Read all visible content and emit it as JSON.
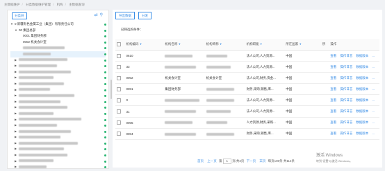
{
  "breadcrumb": [
    "主数据维护",
    "分类数据维护管理",
    "机构",
    "主数据查询"
  ],
  "left": {
    "tab_label": "分类树",
    "tree": [
      {
        "indent": 0,
        "toggle": "▼",
        "label": "0 新疆有色金属工业（集团）有限责任公司",
        "blur": 0,
        "dot": true
      },
      {
        "indent": 1,
        "toggle": "▼",
        "label": "00 集团总部",
        "blur": 0,
        "dot": true
      },
      {
        "indent": 2,
        "toggle": "",
        "label": "0001 集团财务部",
        "blur": 0,
        "dot": true
      },
      {
        "indent": 2,
        "toggle": "",
        "label": "0002 机关会计室",
        "blur": 0,
        "dot": true
      },
      {
        "indent": 2,
        "toggle": "",
        "label": "",
        "blur": 60,
        "dot": true
      },
      {
        "indent": 2,
        "toggle": "",
        "label": "",
        "blur": 40,
        "dot": true,
        "sel": true
      },
      {
        "indent": 1,
        "toggle": "▶",
        "label": "",
        "blur": 70,
        "dot": true
      },
      {
        "indent": 1,
        "toggle": "▶",
        "label": "",
        "blur": 55,
        "dot": true
      },
      {
        "indent": 1,
        "toggle": "▶",
        "label": "",
        "blur": 75,
        "dot": true
      },
      {
        "indent": 1,
        "toggle": "▶",
        "label": "",
        "blur": 50,
        "dot": true
      },
      {
        "indent": 1,
        "toggle": "▶",
        "label": "",
        "blur": 65,
        "dot": true
      },
      {
        "indent": 1,
        "toggle": "▶",
        "label": "",
        "blur": 45,
        "dot": true
      },
      {
        "indent": 1,
        "toggle": "▶",
        "label": "",
        "blur": 80,
        "dot": true
      },
      {
        "indent": 1,
        "toggle": "▶",
        "label": "",
        "blur": 60,
        "dot": true
      },
      {
        "indent": 1,
        "toggle": "▶",
        "label": "",
        "blur": 70,
        "dot": true
      },
      {
        "indent": 1,
        "toggle": "▶",
        "label": "",
        "blur": 50,
        "dot": true
      },
      {
        "indent": 1,
        "toggle": "▶",
        "label": "",
        "blur": 90,
        "dot": true
      },
      {
        "indent": 1,
        "toggle": "▶",
        "label": "",
        "blur": 55,
        "dot": true
      },
      {
        "indent": 1,
        "toggle": "▶",
        "label": "",
        "blur": 75,
        "dot": true
      },
      {
        "indent": 1,
        "toggle": "▶",
        "label": "",
        "blur": 60,
        "dot": true
      },
      {
        "indent": 1,
        "toggle": "▶",
        "label": "",
        "blur": 85,
        "dot": true
      },
      {
        "indent": 1,
        "toggle": "▶",
        "label": "",
        "blur": 65,
        "dot": true
      },
      {
        "indent": 1,
        "toggle": "▶",
        "label": "",
        "blur": 70,
        "dot": true
      },
      {
        "indent": 1,
        "toggle": "▶",
        "label": "",
        "blur": 50,
        "dot": true
      },
      {
        "indent": 1,
        "toggle": "▶",
        "label": "",
        "blur": 40,
        "dot": true
      }
    ]
  },
  "toolbar": {
    "export_label": "导出数据",
    "share_label": "分发"
  },
  "filter_label": "已筛选的条件：",
  "table": {
    "headers": [
      "机构编码",
      "机构名称",
      "机构简称",
      "机构职能",
      "所在国家",
      "所",
      "操作"
    ],
    "rows": [
      {
        "code": "0610",
        "name": "",
        "short": "",
        "func": "法人公司,人力资源...",
        "country": "中国"
      },
      {
        "code": "33",
        "name": "",
        "short": "",
        "func": "法人公司,人力资源...",
        "country": "中国"
      },
      {
        "code": "0002",
        "name": "机关会计室",
        "short": "机关会计室",
        "func": "法人公司,财务,资金...",
        "country": "中国"
      },
      {
        "code": "0001",
        "name": "集团财务部",
        "short": "",
        "func": "财务,采购,销售,库...",
        "country": "中国"
      },
      {
        "code": "0",
        "name": "",
        "short": "",
        "func": "法人公司,人力资源...",
        "country": "中国"
      },
      {
        "code": "31",
        "name": "",
        "short": "",
        "func": "法人公司,人力资源...",
        "country": "中国"
      },
      {
        "code": "0005",
        "name": "",
        "short": "",
        "func": "人力资源,财务,采购...",
        "country": "中国"
      },
      {
        "code": "0004",
        "name": "",
        "short": "",
        "func": "财务,采购,销售,库...",
        "country": "中国"
      }
    ],
    "ops": [
      "查看",
      "操作日志",
      "数据版本",
      "..."
    ]
  },
  "pager": {
    "home": "首页",
    "prev": "上一页",
    "page_prefix": "第",
    "page_value": "1",
    "page_suffix": "页/共2页",
    "next": "下一页",
    "last": "末页",
    "summary": "每页100条 共114条"
  },
  "activate": {
    "line1": "激活 Windows",
    "line2": "转到“设置”以激活 Windows。"
  }
}
